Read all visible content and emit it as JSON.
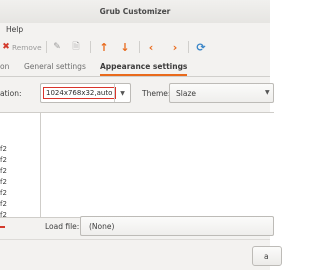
{
  "window": {
    "title": "Grub Customizer"
  },
  "menubar": {
    "help": "Help"
  },
  "toolbar": {
    "remove_label": "Remove"
  },
  "tabs": [
    {
      "label": "on"
    },
    {
      "label": "General settings"
    },
    {
      "label": "Appearance settings"
    }
  ],
  "appearance": {
    "resolution_label": "ation:",
    "resolution_value": "1024x768x32,auto",
    "theme_label": "Theme:",
    "theme_value": "Slaze",
    "list_items": [
      "f2",
      "f2",
      "f2",
      "f2",
      "f2",
      "f2",
      "f2"
    ],
    "load_file_label": "Load file:",
    "load_file_value": "(None)"
  },
  "footer": {
    "button_label": "a"
  },
  "colors": {
    "accent_orange": "#e96a1c",
    "arrow_blue": "#3a86c8",
    "error_red": "#d9342b"
  }
}
